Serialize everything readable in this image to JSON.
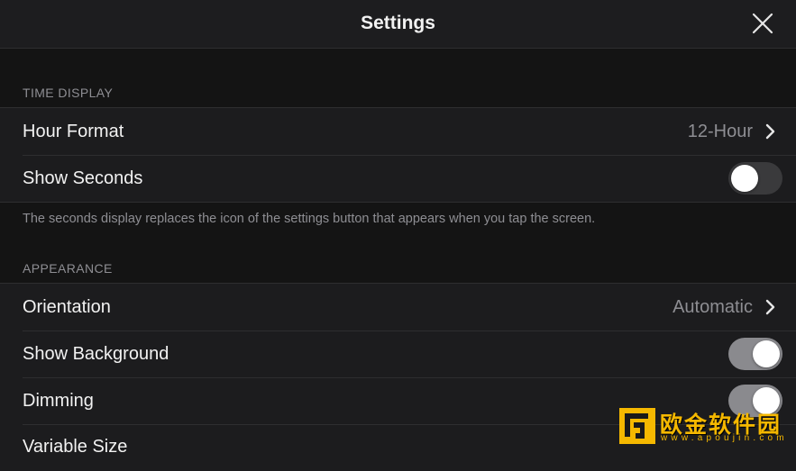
{
  "header": {
    "title": "Settings",
    "close_icon": "close-icon"
  },
  "sections": {
    "time_display": {
      "title": "TIME DISPLAY",
      "hour_format": {
        "label": "Hour Format",
        "value": "12-Hour"
      },
      "show_seconds": {
        "label": "Show Seconds",
        "on": false
      },
      "note": "The seconds display replaces the icon of the settings button that appears when you tap the screen."
    },
    "appearance": {
      "title": "APPEARANCE",
      "orientation": {
        "label": "Orientation",
        "value": "Automatic"
      },
      "show_background": {
        "label": "Show Background",
        "on": true
      },
      "dimming": {
        "label": "Dimming",
        "on": true
      },
      "variable_size": {
        "label": "Variable Size"
      }
    }
  },
  "watermark": {
    "text": "欧金软件园",
    "sub": "www.apoujin.com"
  },
  "colors": {
    "background": "#141414",
    "cell": "#1c1c1e",
    "secondary_text": "#8e8e93",
    "watermark": "#f5b800"
  }
}
